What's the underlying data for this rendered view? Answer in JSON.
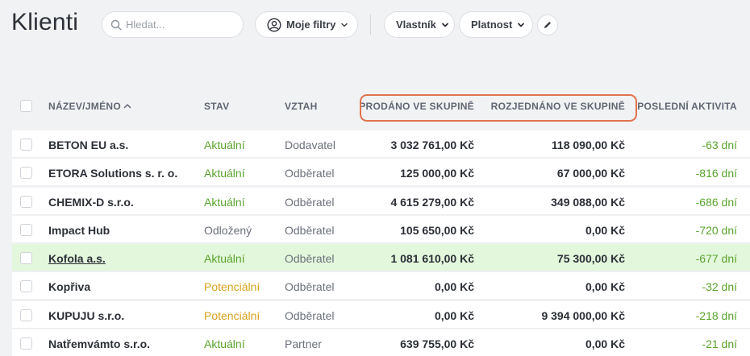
{
  "page": {
    "title": "Klienti"
  },
  "toolbar": {
    "search_placeholder": "Hledat...",
    "my_filters": "Moje filtry",
    "owner": "Vlastník",
    "validity": "Platnost"
  },
  "table": {
    "columns": {
      "name": "NÁZEV/JMÉNO",
      "status": "STAV",
      "relation": "VZTAH",
      "sold": "PRODÁNO VE SKUPINĚ",
      "negotiated": "ROZJEDNÁNO VE SKUPINĚ",
      "last_activity": "POSLEDNÍ AKTIVITA"
    },
    "colors": {
      "current": "#5aa32c",
      "potential": "#d8a21c",
      "postponed": "#6b717b",
      "highlight": "#e2734d",
      "selected_row": "#e3f7dc"
    },
    "rows": [
      {
        "name": "BETON EU a.s.",
        "status": "Aktuální",
        "status_type": "current",
        "relation": "Dodavatel",
        "sold": "3 032 761,00 Kč",
        "negotiated": "118 090,00 Kč",
        "last_activity": "-63 dní",
        "selected": false
      },
      {
        "name": "ETORA Solutions s. r. o.",
        "status": "Aktuální",
        "status_type": "current",
        "relation": "Odběratel",
        "sold": "125 000,00 Kč",
        "negotiated": "67 000,00 Kč",
        "last_activity": "-816 dní",
        "selected": false
      },
      {
        "name": "CHEMIX-D s.r.o.",
        "status": "Aktuální",
        "status_type": "current",
        "relation": "Odběratel",
        "sold": "4 615 279,00 Kč",
        "negotiated": "349 088,00 Kč",
        "last_activity": "-686 dní",
        "selected": false
      },
      {
        "name": "Impact Hub",
        "status": "Odložený",
        "status_type": "postponed",
        "relation": "Odběratel",
        "sold": "105 650,00 Kč",
        "negotiated": "0,00 Kč",
        "last_activity": "-720 dní",
        "selected": false
      },
      {
        "name": "Kofola a.s.",
        "status": "Aktuální",
        "status_type": "current",
        "relation": "Odběratel",
        "sold": "1 081 610,00 Kč",
        "negotiated": "75 300,00 Kč",
        "last_activity": "-677 dní",
        "selected": true
      },
      {
        "name": "Kopřiva",
        "status": "Potenciální",
        "status_type": "potential",
        "relation": "Odběratel",
        "sold": "0,00 Kč",
        "negotiated": "0,00 Kč",
        "last_activity": "-32 dní",
        "selected": false
      },
      {
        "name": "KUPUJU s.r.o.",
        "status": "Potenciální",
        "status_type": "potential",
        "relation": "Odběratel",
        "sold": "0,00 Kč",
        "negotiated": "9 394 000,00 Kč",
        "last_activity": "-218 dní",
        "selected": false
      },
      {
        "name": "Natřemvámto s.r.o.",
        "status": "Aktuální",
        "status_type": "current",
        "relation": "Partner",
        "sold": "639 755,00 Kč",
        "negotiated": "0,00 Kč",
        "last_activity": "-21 dní",
        "selected": false
      }
    ]
  }
}
